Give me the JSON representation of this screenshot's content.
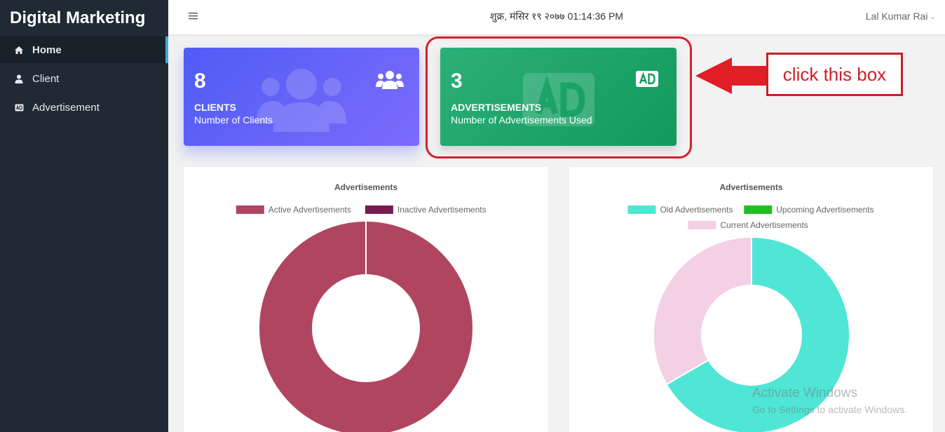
{
  "sidebar": {
    "brand": "Digital Marketing",
    "items": [
      {
        "label": "Home",
        "icon": "home-icon"
      },
      {
        "label": "Client",
        "icon": "user-icon"
      },
      {
        "label": "Advertisement",
        "icon": "ad-icon"
      }
    ]
  },
  "topbar": {
    "datetime": "शुक्र, मंसिर १९ २०७७ 01:14:36 PM",
    "user": "Lal Kumar Rai"
  },
  "cards": {
    "clients": {
      "count": "8",
      "title": "CLIENTS",
      "subtitle": "Number of Clients",
      "icon": "users-icon"
    },
    "ads": {
      "count": "3",
      "title": "ADVERTISEMENTS",
      "subtitle": "Number of Advertisements Used",
      "icon": "ad-icon"
    }
  },
  "annotation": {
    "callout": "click this box"
  },
  "colors": {
    "active": "#b04560",
    "inactive": "#7a1a52",
    "old": "#4fe6d6",
    "upcoming": "#1ec021",
    "current": "#f3d0e4"
  },
  "chart_data": [
    {
      "type": "pie",
      "title": "Advertisements",
      "labels": [
        "Active Advertisements",
        "Inactive Advertisements"
      ],
      "values": [
        3,
        0
      ],
      "colors": [
        "#b04560",
        "#7a1a52"
      ],
      "legend": "top"
    },
    {
      "type": "pie",
      "title": "Advertisements",
      "labels": [
        "Old Advertisements",
        "Upcoming Advertisements",
        "Current Advertisements"
      ],
      "values": [
        2,
        0,
        1
      ],
      "colors": [
        "#4fe6d6",
        "#1ec021",
        "#f3d0e4"
      ],
      "legend": "top"
    }
  ],
  "watermark": {
    "line1": "Activate Windows",
    "line2": "Go to Settings to activate Windows."
  }
}
